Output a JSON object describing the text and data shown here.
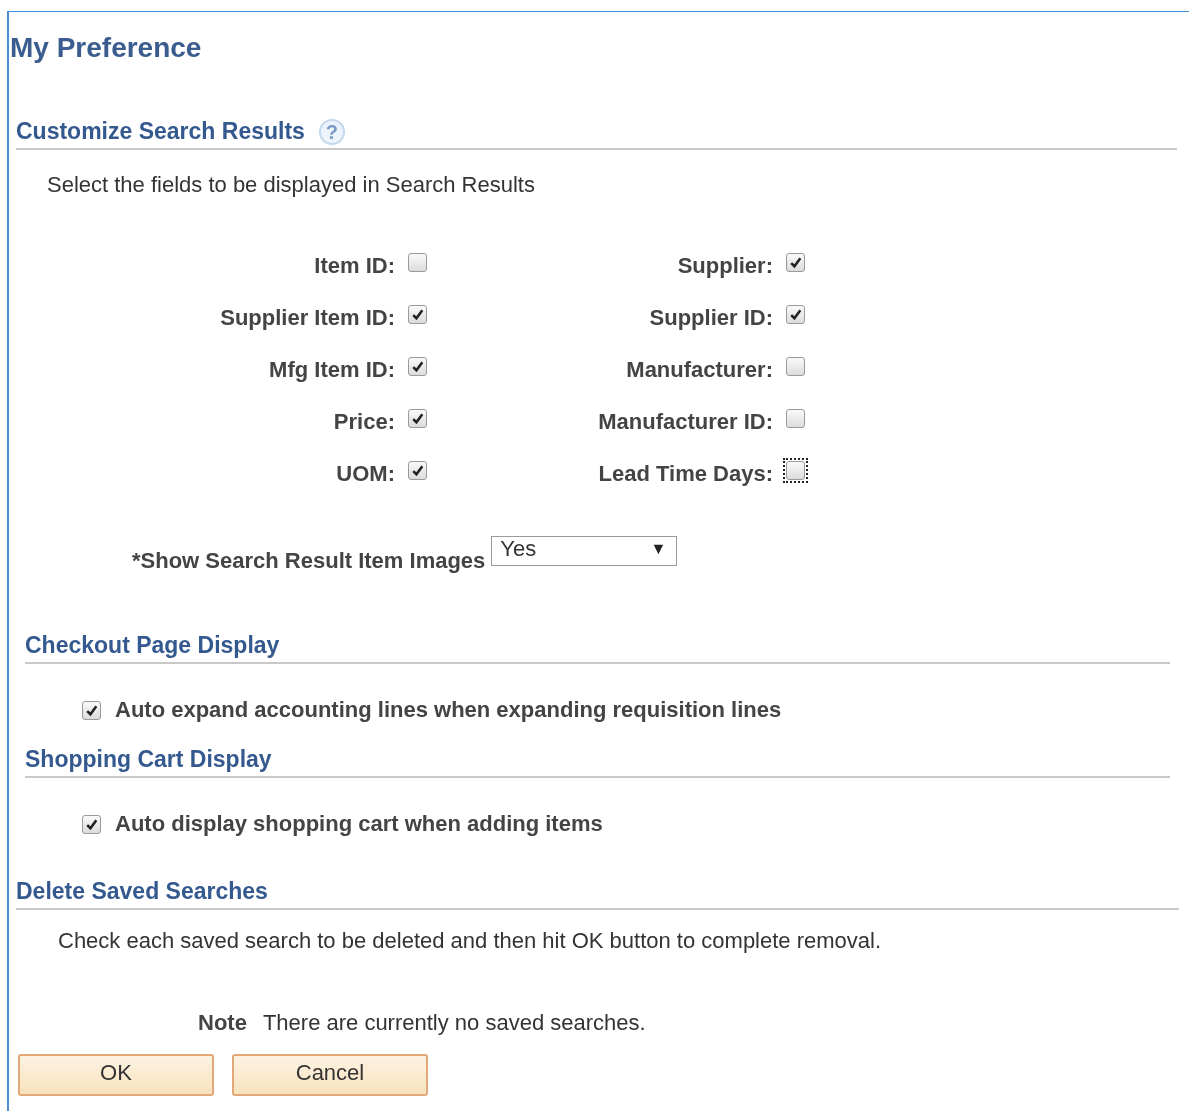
{
  "title": "My Preference",
  "sections": [
    {
      "kind": "search_results",
      "heading": "Customize Search Results",
      "help_icon": "?",
      "description": "Select the fields to be displayed in Search Results",
      "field_rows": [
        [
          {
            "label": "Item ID:",
            "checked": false,
            "focused": false
          },
          {
            "label": "Supplier:",
            "checked": true,
            "focused": false
          }
        ],
        [
          {
            "label": "Supplier Item ID:",
            "checked": true,
            "focused": false
          },
          {
            "label": "Supplier ID:",
            "checked": true,
            "focused": false
          }
        ],
        [
          {
            "label": "Mfg Item ID:",
            "checked": true,
            "focused": false
          },
          {
            "label": "Manufacturer:",
            "checked": false,
            "focused": false
          }
        ],
        [
          {
            "label": "Price:",
            "checked": true,
            "focused": false
          },
          {
            "label": "Manufacturer ID:",
            "checked": false,
            "focused": false
          }
        ],
        [
          {
            "label": "UOM:",
            "checked": true,
            "focused": false
          },
          {
            "label": "Lead Time Days:",
            "checked": false,
            "focused": true
          }
        ]
      ],
      "dropdown": {
        "required_mark": "*",
        "label": "Show Search Result Item Images",
        "value": "Yes",
        "arrow": "▼"
      }
    },
    {
      "kind": "option",
      "heading": "Checkout Page Display",
      "option": {
        "label": "Auto expand accounting lines when expanding requisition lines",
        "checked": true
      }
    },
    {
      "kind": "option",
      "heading": "Shopping Cart Display",
      "option": {
        "label": "Auto display shopping cart when adding items",
        "checked": true
      }
    },
    {
      "kind": "delete",
      "heading": "Delete Saved Searches",
      "description": "Check each saved search to be deleted and then hit OK button to complete removal.",
      "note_label": "Note",
      "note": "There are currently no saved searches."
    }
  ],
  "buttons": [
    "OK",
    "Cancel"
  ]
}
